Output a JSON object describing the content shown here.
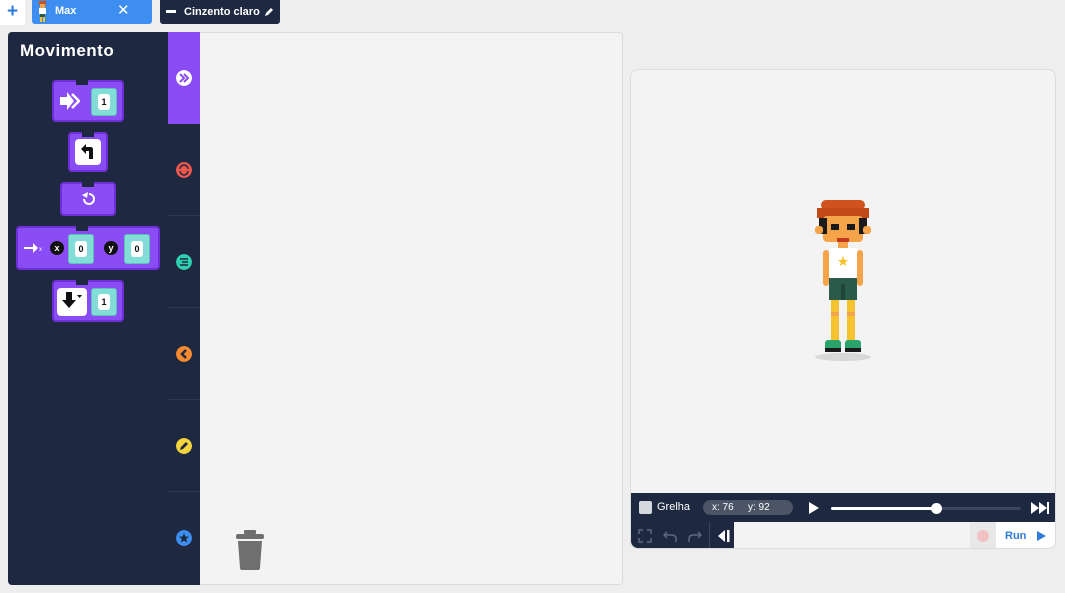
{
  "topbar": {
    "add_label": "+",
    "sprite_tab": {
      "name": "Max",
      "close_label": "✕"
    },
    "background_tab": {
      "name": "Cinzento claro"
    }
  },
  "palette": {
    "title": "Movimento",
    "blocks": [
      {
        "name": "move-forward-block",
        "value": "1"
      },
      {
        "name": "turn-block"
      },
      {
        "name": "reset-rotation-block"
      },
      {
        "name": "go-to-xy-block",
        "x_label": "x",
        "x_value": "0",
        "y_label": "y",
        "y_value": "0"
      },
      {
        "name": "move-direction-block",
        "value": "1"
      }
    ]
  },
  "categories": [
    {
      "name": "movement",
      "color": "#ffffff",
      "active": true
    },
    {
      "name": "looks",
      "color": "#f0584f"
    },
    {
      "name": "sound",
      "color": "#2fd0b0"
    },
    {
      "name": "events",
      "color": "#f58a2f"
    },
    {
      "name": "pen",
      "color": "#f5d53d"
    },
    {
      "name": "custom",
      "color": "#3d8ef0"
    }
  ],
  "stage": {
    "grid_label": "Grelha",
    "coord_x": "x: 76",
    "coord_y": "y: 92",
    "speed_fraction": 0.55,
    "run_label": "Run"
  },
  "colors": {
    "accent_blue": "#3d8ef0",
    "navy": "#1e2840",
    "block_purple": "#8a4cf5",
    "socket_cyan": "#82ddd8"
  }
}
